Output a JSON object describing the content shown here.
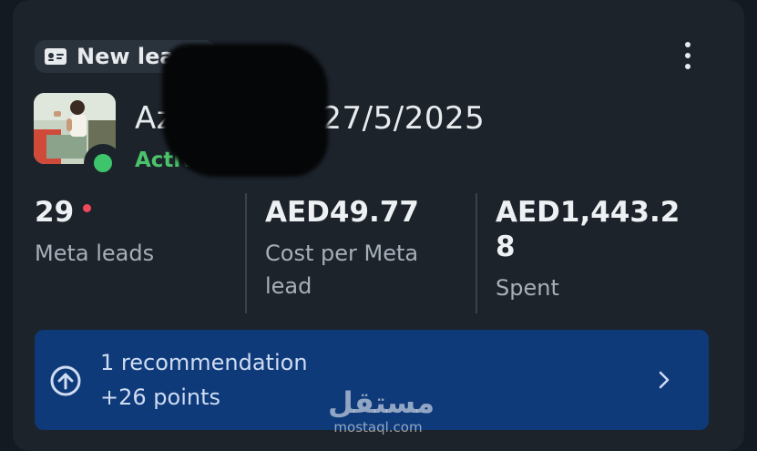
{
  "chip": {
    "icon": "id-card-icon",
    "label": "New leads"
  },
  "menu": {
    "icon": "more-vertical-icon"
  },
  "campaign": {
    "name": "Azi",
    "name_tail": "n 27/5/2025",
    "status": "Active",
    "separator": "•",
    "type": "Leads",
    "status_color": "#4cc36b"
  },
  "metrics": [
    {
      "value": "29",
      "label": "Meta leads",
      "has_dot": true
    },
    {
      "value": "AED49.77",
      "label": "Cost per Meta lead"
    },
    {
      "value": "AED1,443.28",
      "label": "Spent"
    }
  ],
  "recommendation": {
    "icon": "arrow-up-circle-icon",
    "title": "1 recommendation",
    "subtitle": "+26 points",
    "chevron": "chevron-right-icon",
    "background": "#0e3a7a"
  },
  "watermark": {
    "arabic": "مستقل",
    "site": "mostaql.com"
  },
  "colors": {
    "card": "#1c232b",
    "page": "#141a21",
    "alert_dot": "#f04a5a"
  }
}
